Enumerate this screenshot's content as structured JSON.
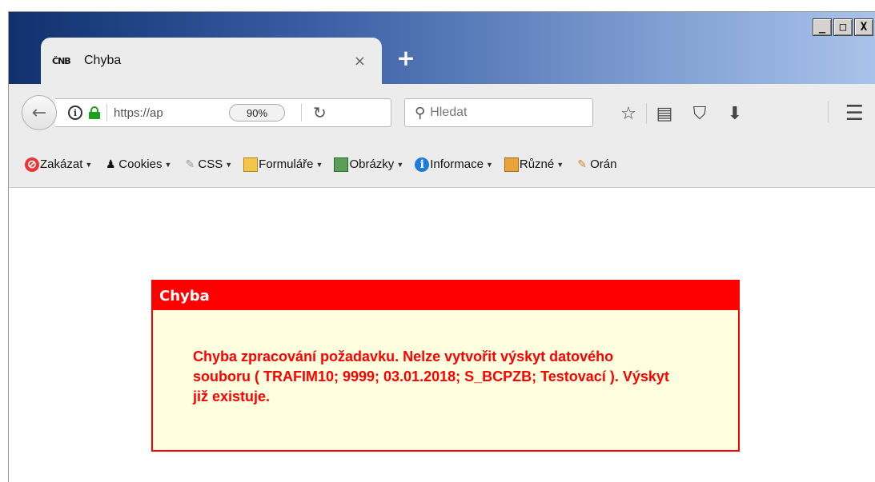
{
  "window": {
    "controls": {
      "minimize": "_",
      "maximize": "□",
      "close": "X"
    }
  },
  "tab": {
    "favicon_text": "ČNB",
    "title": "Chyba",
    "close_glyph": "×",
    "new_tab_glyph": "+"
  },
  "navbar": {
    "url": "https://ap",
    "zoom": "90%",
    "search_placeholder": "Hledat",
    "icons": [
      "back-icon",
      "info-icon",
      "lock-icon",
      "reload-icon",
      "search-icon",
      "star-icon",
      "reading-list-icon",
      "pocket-icon",
      "download-icon",
      "menu-icon"
    ]
  },
  "devbar": {
    "items": [
      {
        "label": "Zakázat",
        "icon": "disable-icon"
      },
      {
        "label": "Cookies",
        "icon": "cookies-icon"
      },
      {
        "label": "CSS",
        "icon": "css-icon"
      },
      {
        "label": "Formuláře",
        "icon": "forms-icon"
      },
      {
        "label": "Obrázky",
        "icon": "images-icon"
      },
      {
        "label": "Informace",
        "icon": "info-icon"
      },
      {
        "label": "Různé",
        "icon": "misc-icon"
      },
      {
        "label": "Orán",
        "icon": "outline-icon"
      }
    ]
  },
  "error": {
    "title": "Chyba",
    "message": "Chyba zpracování požadavku. Nelze vytvořit výskyt datového souboru ( TRAFIM10; 9999; 03.01.2018; S_BCPZB; Testovací ). Výskyt již existuje.",
    "colors": {
      "border": "#ff0000",
      "header": "#ff0000",
      "background": "#ffffe0",
      "text": "#ff0000"
    }
  }
}
